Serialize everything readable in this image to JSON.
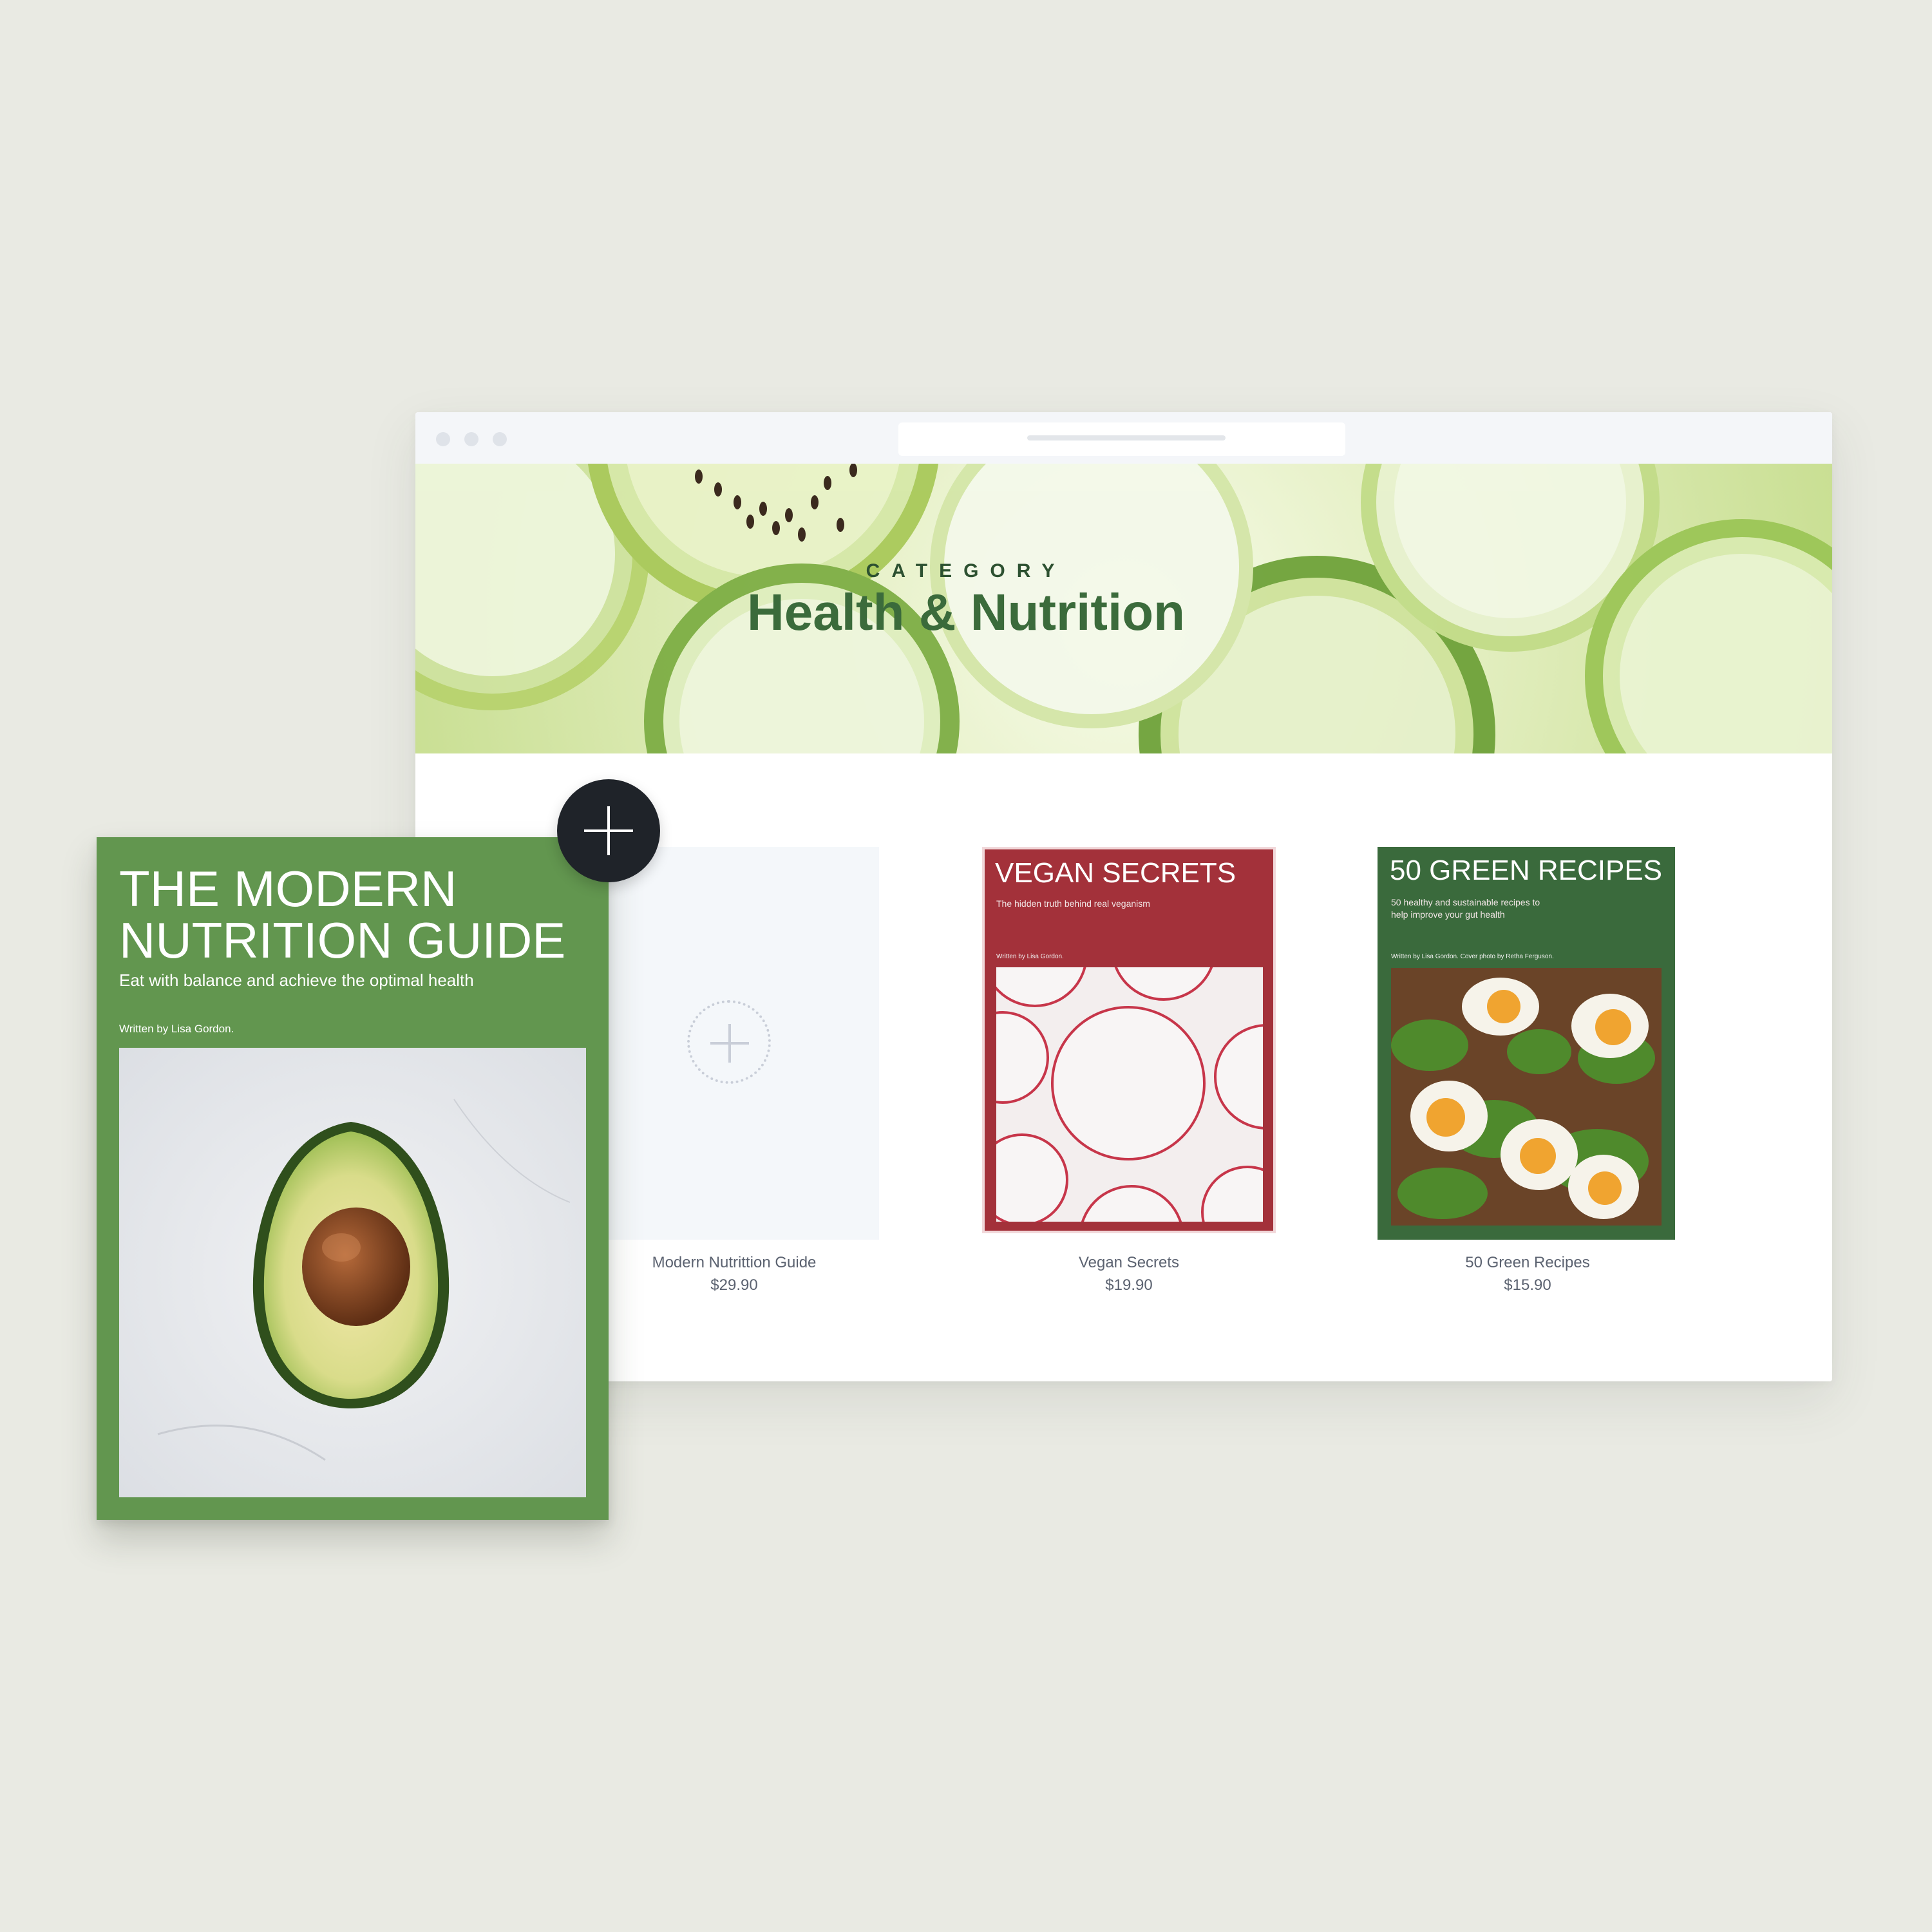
{
  "banner": {
    "eyebrow": "CATEGORY",
    "title": "Health & Nutrition"
  },
  "products": [
    {
      "name": "Modern Nutrittion Guide",
      "price": "$29.90"
    },
    {
      "name": "Vegan Secrets",
      "price": "$19.90"
    },
    {
      "name": "50 Green Recipes",
      "price": "$15.90"
    }
  ],
  "covers": {
    "vegan": {
      "title": "VEGAN SECRETS",
      "subtitle": "The hidden truth behind real veganism",
      "author": "Written by Lisa Gordon."
    },
    "green": {
      "title": "50 GREEN RECIPES",
      "subtitle_line1": "50 healthy and sustainable recipes to",
      "subtitle_line2": "help improve your gut health",
      "author": "Written by Lisa Gordon. Cover photo by Retha Ferguson."
    }
  },
  "book": {
    "title_line1": "THE MODERN",
    "title_line2": "NUTRITION GUIDE",
    "subtitle": "Eat with balance and achieve the optimal health",
    "author": "Written by Lisa Gordon."
  },
  "icons": {
    "add_button": "plus-icon",
    "placeholder": "plus-icon"
  },
  "colors": {
    "background": "#e9eae3",
    "banner_title": "#3b6b3b",
    "book_green": "#62964f",
    "vegan_red": "#a3313a",
    "recipes_green": "#3a6a3c",
    "add_button": "#1f2329"
  }
}
